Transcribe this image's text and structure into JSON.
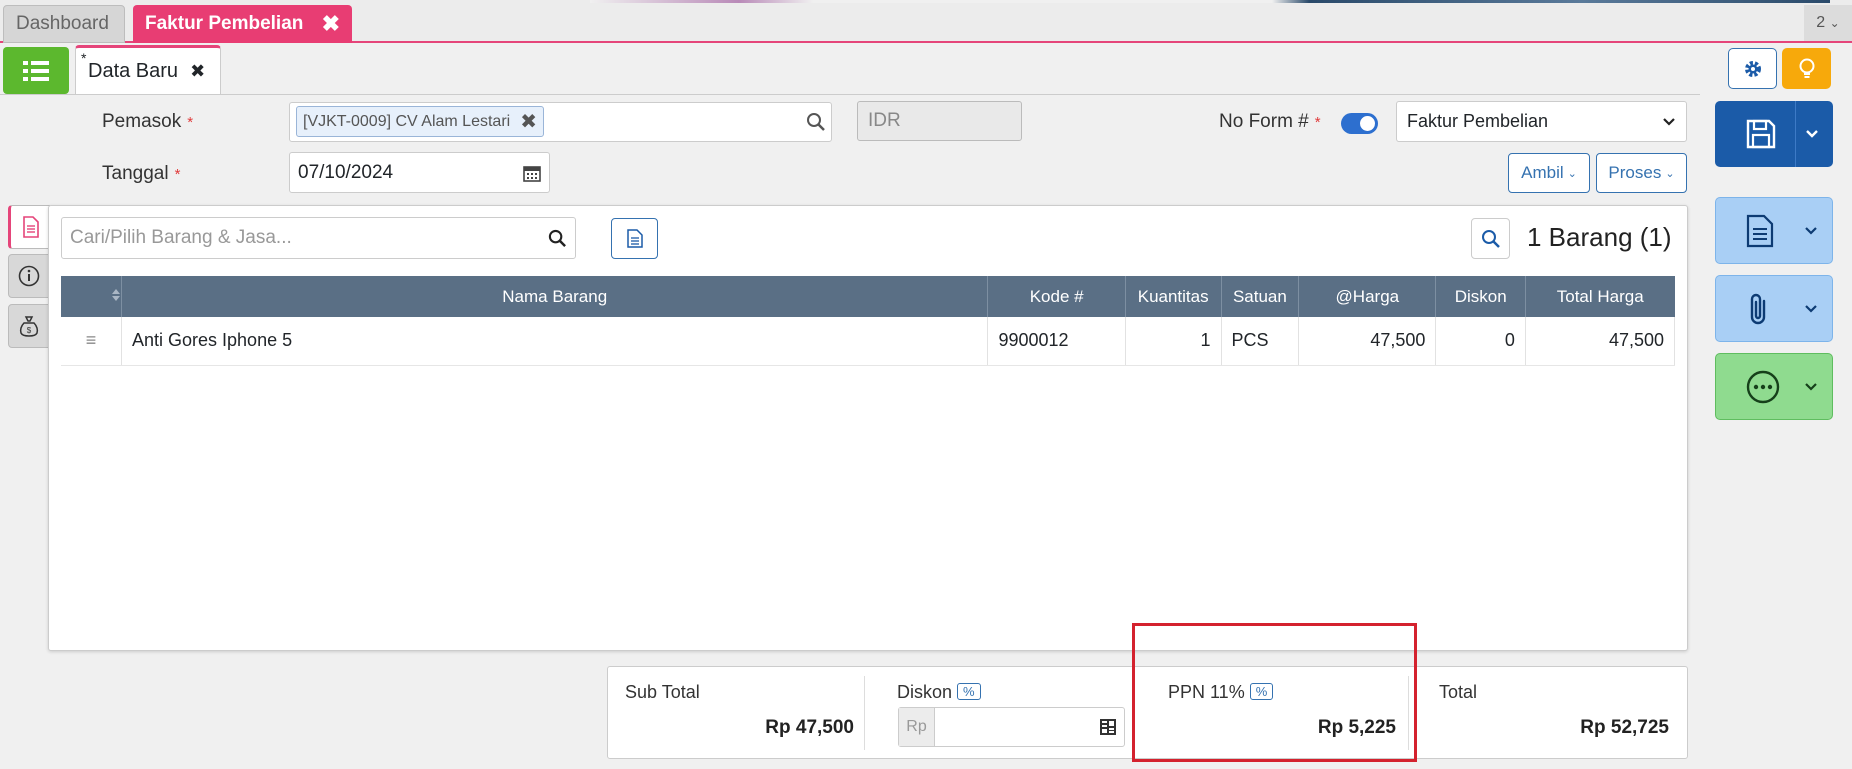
{
  "tabs": {
    "dashboard": "Dashboard",
    "active": "Faktur Pembelian",
    "close": "✖",
    "count": "2"
  },
  "subtab": {
    "star": "*",
    "label": "Data Baru",
    "close": "✖"
  },
  "form": {
    "pemasok_label": "Pemasok",
    "required": "*",
    "pemasok_value": "[VJKT-0009] CV Alam Lestari",
    "chip_close": "✖",
    "currency": "IDR",
    "noform_label": "No Form #",
    "form_type": "Faktur Pembelian",
    "tanggal_label": "Tanggal",
    "tanggal_value": "07/10/2024",
    "ambil": "Ambil",
    "proses": "Proses"
  },
  "items": {
    "search_placeholder": "Cari/Pilih Barang & Jasa...",
    "count": "1 Barang (1)",
    "columns": [
      "",
      "Nama Barang",
      "Kode #",
      "Kuantitas",
      "Satuan",
      "@Harga",
      "Diskon",
      "Total Harga"
    ],
    "rows": [
      {
        "handle": "≡",
        "nama": "Anti Gores Iphone 5",
        "kode": "9900012",
        "qty": "1",
        "satuan": "PCS",
        "harga": "47,500",
        "diskon": "0",
        "total": "47,500"
      }
    ]
  },
  "summary": {
    "subtotal_label": "Sub Total",
    "subtotal_value": "Rp 47,500",
    "diskon_label": "Diskon",
    "pct": "%",
    "rp": "Rp",
    "ppn_label": "PPN 11%",
    "ppn_value": "Rp 5,225",
    "total_label": "Total",
    "total_value": "Rp 52,725"
  },
  "colors": {
    "accent": "#e5457a",
    "primary": "#1b5ba8",
    "green": "#5cb82e",
    "highlight": "#d4222e"
  },
  "icons": [
    "list-icon",
    "gear-icon",
    "bulb-icon",
    "search-icon",
    "calendar-icon",
    "document-icon",
    "info-icon",
    "money-bag-icon",
    "save-icon",
    "paperclip-icon",
    "more-icon",
    "chevron-down-icon",
    "calculator-icon",
    "sort-icon"
  ]
}
